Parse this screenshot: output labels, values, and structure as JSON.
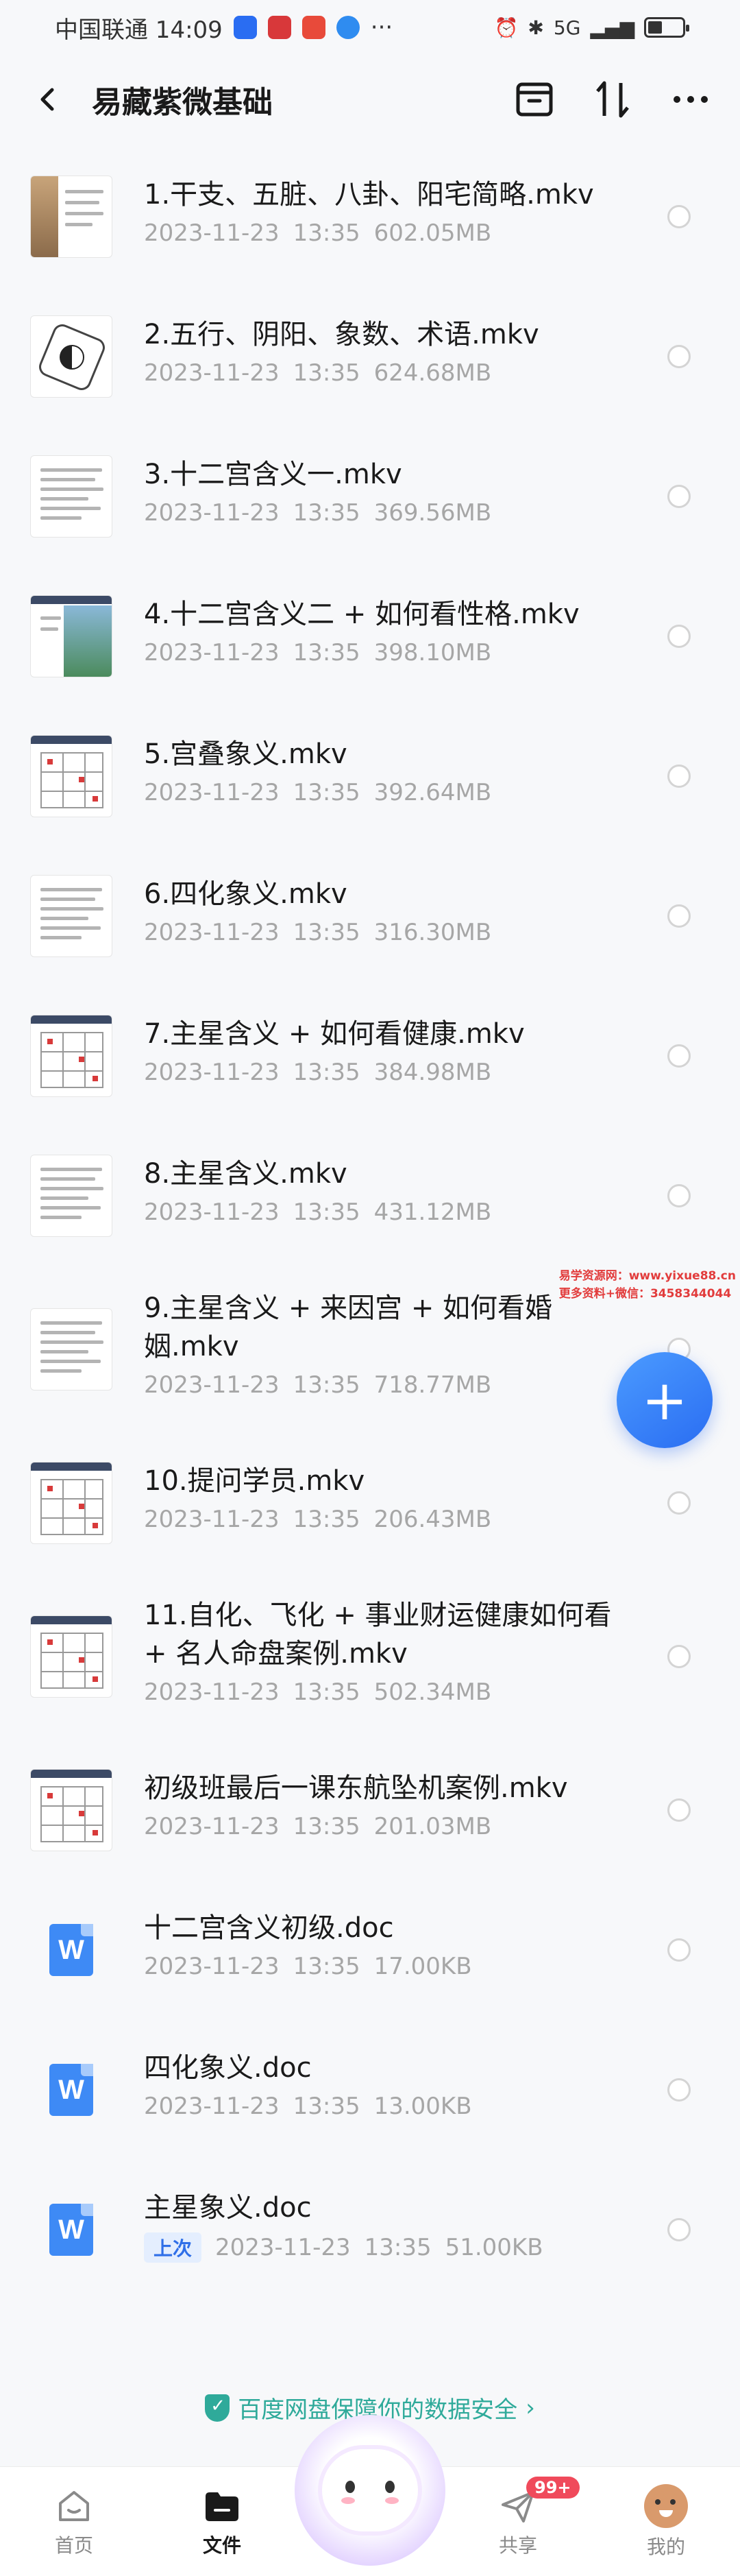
{
  "status_bar": {
    "carrier_time": "中国联通 14:09",
    "more": "···",
    "signal": "5G"
  },
  "header": {
    "title": "易藏紫微基础"
  },
  "files": [
    {
      "name": "1.干支、五脏、八卦、阳宅简略.mkv",
      "date": "2023-11-23",
      "time": "13:35",
      "size": "602.05MB",
      "thumb": "photo"
    },
    {
      "name": "2.五行、阴阳、象数、术语.mkv",
      "date": "2023-11-23",
      "time": "13:35",
      "size": "624.68MB",
      "thumb": "bagua"
    },
    {
      "name": "3.十二宫含义一.mkv",
      "date": "2023-11-23",
      "time": "13:35",
      "size": "369.56MB",
      "thumb": "text"
    },
    {
      "name": "4.十二宫含义二 + 如何看性格.mkv",
      "date": "2023-11-23",
      "time": "13:35",
      "size": "398.10MB",
      "thumb": "landscape"
    },
    {
      "name": "5.宫叠象义.mkv",
      "date": "2023-11-23",
      "time": "13:35",
      "size": "392.64MB",
      "thumb": "chart"
    },
    {
      "name": "6.四化象义.mkv",
      "date": "2023-11-23",
      "time": "13:35",
      "size": "316.30MB",
      "thumb": "text"
    },
    {
      "name": "7.主星含义 + 如何看健康.mkv",
      "date": "2023-11-23",
      "time": "13:35",
      "size": "384.98MB",
      "thumb": "chart"
    },
    {
      "name": "8.主星含义.mkv",
      "date": "2023-11-23",
      "time": "13:35",
      "size": "431.12MB",
      "thumb": "text"
    },
    {
      "name": "9.主星含义 + 来因宫 + 如何看婚姻.mkv",
      "date": "2023-11-23",
      "time": "13:35",
      "size": "718.77MB",
      "thumb": "text"
    },
    {
      "name": "10.提问学员.mkv",
      "date": "2023-11-23",
      "time": "13:35",
      "size": "206.43MB",
      "thumb": "chart"
    },
    {
      "name": "11.自化、飞化 + 事业财运健康如何看 + 名人命盘案例.mkv",
      "date": "2023-11-23",
      "time": "13:35",
      "size": "502.34MB",
      "thumb": "chart"
    },
    {
      "name": "初级班最后一课东航坠机案例.mkv",
      "date": "2023-11-23",
      "time": "13:35",
      "size": "201.03MB",
      "thumb": "chart"
    },
    {
      "name": "十二宫含义初级.doc",
      "date": "2023-11-23",
      "time": "13:35",
      "size": "17.00KB",
      "thumb": "doc"
    },
    {
      "name": "四化象义.doc",
      "date": "2023-11-23",
      "time": "13:35",
      "size": "13.00KB",
      "thumb": "doc"
    },
    {
      "name": "主星象义.doc",
      "date": "2023-11-23",
      "time": "13:35",
      "size": "51.00KB",
      "thumb": "doc",
      "badge": "上次"
    }
  ],
  "doc_icon_letter": "W",
  "watermark": {
    "line1": "易学资源网：www.yixue88.cn",
    "line2": "更多资料+微信：3458344044"
  },
  "fab": {
    "symbol": "+"
  },
  "security_tip": {
    "text": "百度网盘保障你的数据安全",
    "arrow": "›"
  },
  "bottom_nav": {
    "home": "首页",
    "files": "文件",
    "share": "共享",
    "mine": "我的",
    "share_badge": "99+"
  },
  "colors": {
    "accent": "#2f6fe8",
    "doc_blue": "#3e8af5",
    "tip_green": "#2faa9a",
    "badge_red": "#f04a5b"
  }
}
